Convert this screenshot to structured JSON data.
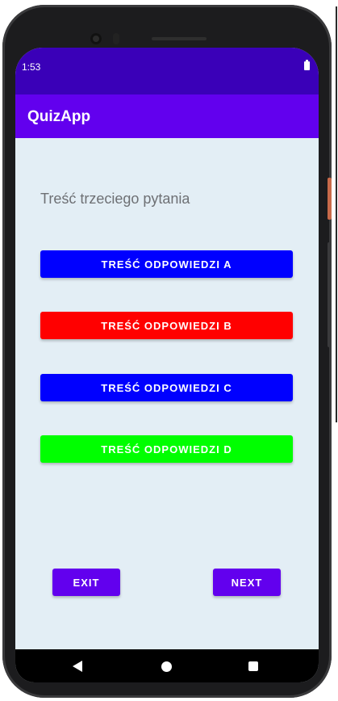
{
  "status_bar": {
    "time": "1:53",
    "battery_icon": "battery-full-icon"
  },
  "app_bar": {
    "title": "QuizApp"
  },
  "question": {
    "text": "Treść trzeciego pytania"
  },
  "answers": [
    {
      "label": "TREŚĆ ODPOWIEDZI A",
      "color": "#0000ff"
    },
    {
      "label": "TREŚĆ ODPOWIEDZI B",
      "color": "#ff0000"
    },
    {
      "label": "TREŚĆ ODPOWIEDZI C",
      "color": "#0000ff"
    },
    {
      "label": "TREŚĆ ODPOWIEDZI D",
      "color": "#00ff00"
    }
  ],
  "navigation": {
    "exit_label": "EXIT",
    "next_label": "NEXT"
  },
  "system_nav": {
    "back_icon": "back-triangle-icon",
    "home_icon": "home-circle-icon",
    "recents_icon": "recents-square-icon"
  },
  "colors": {
    "primary": "#6200ee",
    "primary_dark": "#3a00b8",
    "background": "#e3eef5"
  }
}
